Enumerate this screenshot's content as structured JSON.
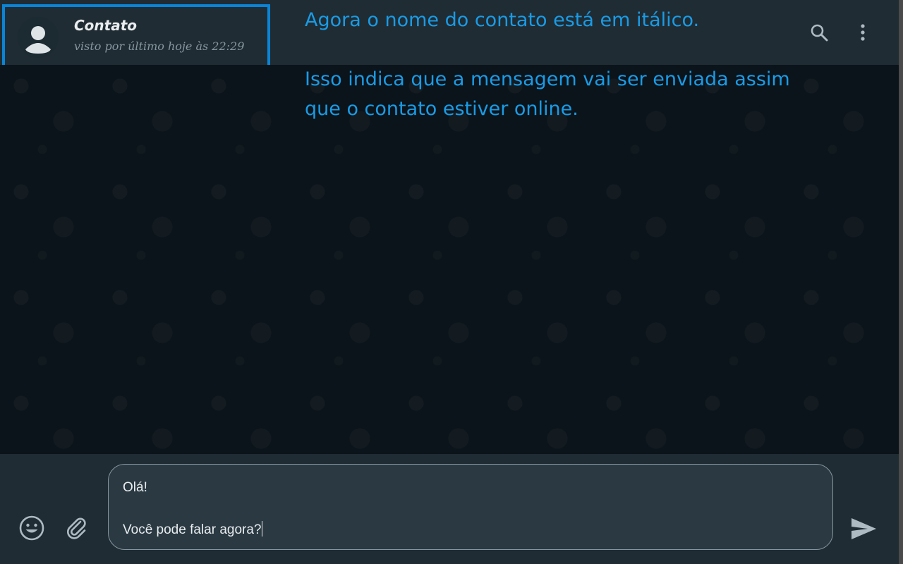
{
  "header": {
    "contact_name": "Contato",
    "contact_status": "visto por último hoje às 22:29",
    "search_icon": "search-icon",
    "menu_icon": "more-vertical-icon"
  },
  "annotations": {
    "note_1": "Agora o nome do contato está em itálico.",
    "note_2": "Isso indica que a mensagem vai ser enviada assim que o contato estiver online."
  },
  "composer": {
    "lines": [
      "Olá!",
      "",
      "Você pode falar agora?"
    ],
    "emoji_icon": "emoji-icon",
    "attach_icon": "paperclip-icon",
    "send_icon": "send-icon"
  },
  "colors": {
    "header_bg": "#202c33",
    "chat_bg": "#0b141a",
    "annotation_accent": "#1a9be6",
    "highlight_border": "#0a84d6"
  }
}
